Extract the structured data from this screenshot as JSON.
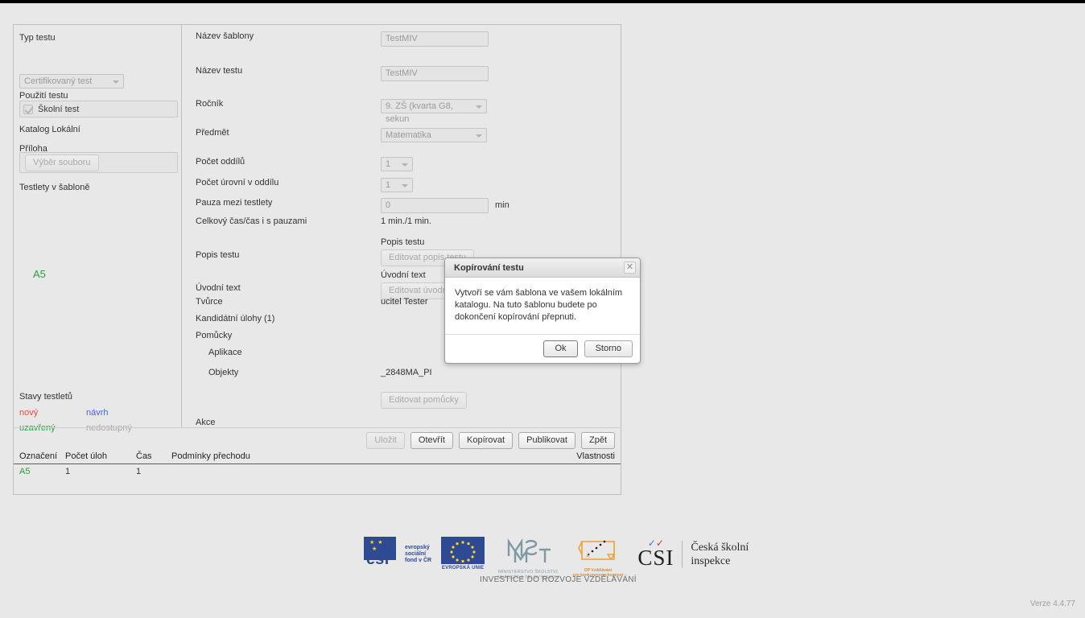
{
  "left_panel": {
    "typ_testu_label": "Typ testu",
    "typ_testu_value": "Certifikovaný test",
    "pouziti_testu_label": "Použití testu",
    "skolni_test_label": "Školní test",
    "katalog_label": "Katalog Lokální",
    "priloha_label": "Příloha",
    "vyber_souboru_button": "Výběr souboru",
    "testlety_label": "Testlety v šabloně",
    "testlet_item": "A5",
    "stavy_label": "Stavy testletů",
    "stavy": [
      {
        "label": "nový",
        "color": "#e24a43"
      },
      {
        "label": "návrh",
        "color": "#4a63d8"
      },
      {
        "label": "uzavřený",
        "color": "#2f9c3f"
      },
      {
        "label": "nedostupný",
        "color": "#a8a8a8"
      }
    ]
  },
  "form": {
    "nazev_sablony_label": "Název šablony",
    "nazev_sablony_value": "TestMIV",
    "nazev_testu_label": "Název testu",
    "nazev_testu_value": "TestMIV",
    "rocnik_label": "Ročník",
    "rocnik_value": "9. ZŠ (kvarta G8, sekun",
    "predmet_label": "Předmět",
    "predmet_value": "Matematika",
    "pocet_oddilu_label": "Počet oddílů",
    "pocet_oddilu_value": "1",
    "pocet_urovni_label": "Počet úrovní v oddílu",
    "pocet_urovni_value": "1",
    "pauza_label": "Pauza mezi testlety",
    "pauza_value": "0",
    "pauza_unit": "min",
    "celkovy_cas_label": "Celkový čas/čas i s pauzami",
    "celkovy_cas_value": "1 min./1 min.",
    "popis_testu_label": "Popis testu",
    "popis_testu_sublabel": "Popis testu",
    "popis_testu_button": "Editovat popis testu",
    "uvodni_text_label": "Úvodní text",
    "uvodni_text_sublabel": "Úvodní text",
    "uvodni_text_button": "Editovat úvodní",
    "tvurce_label": "Tvůrce",
    "tvurce_value": "ucitel Tester",
    "kandidatni_ulohy_link": "Kandidátní úlohy (1)",
    "pomucky_label": "Pomůcky",
    "aplikace_label": "Aplikace",
    "objekty_label": "Objekty",
    "objekty_value": "_2848MA_PI",
    "editovat_pomucky_button": "Editovat pomůcky",
    "akce_label": "Akce"
  },
  "actions": {
    "ulozit": "Uložit",
    "otevrit": "Otevřít",
    "kopirovat": "Kopírovat",
    "publikovat": "Publikovat",
    "zpet": "Zpět"
  },
  "table": {
    "headers": [
      "Označení",
      "Počet úloh",
      "Čas",
      "Podmínky přechodu",
      "Vlastnosti"
    ],
    "rows": [
      {
        "oznaceni": "A5",
        "pocet_uloh": "1",
        "cas": "1",
        "podminky": "",
        "vlastnosti": ""
      }
    ]
  },
  "dialog": {
    "title": "Kopírování testu",
    "close_icon": "close-icon",
    "message": "Vytvoří se vám šablona ve vašem lokálním katalogu. Na tuto šablonu budete po dokončení kopírování přepnuti.",
    "ok_button": "Ok",
    "cancel_button": "Storno"
  },
  "footer": {
    "esf_line1": "evropský",
    "esf_line2": "sociální",
    "esf_line3": "fond v ČR",
    "esf_mark": "esf",
    "eu_caption": "EVROPSKÁ UNIE",
    "msmt_line1": "MINISTERSTVO ŠKOLSTVÍ,",
    "msmt_line2": "MLÁDEŽE A TĚLOVÝCHOVY",
    "msmt_mark": "MŠMT",
    "opvk_line1": "OP Vzdělávání",
    "opvk_line2": "pro konkurenceschopnost",
    "csi_mark": "CSI",
    "csi_line1": "Česká školní",
    "csi_line2": "inspekce",
    "investice": "INVESTICE DO ROZVOJE VZDĚLÁVÁNÍ",
    "verze": "Verze 4.4.77"
  }
}
